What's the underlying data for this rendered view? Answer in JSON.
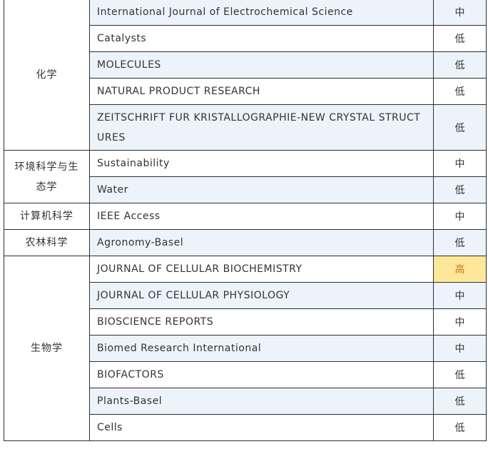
{
  "groups": [
    {
      "category": "化学",
      "rows": [
        {
          "journal": "International Journal of Electrochemical Science",
          "level": "中"
        },
        {
          "journal": "Catalysts",
          "level": "低"
        },
        {
          "journal": "MOLECULES",
          "level": "低"
        },
        {
          "journal": "NATURAL PRODUCT RESEARCH",
          "level": "低"
        },
        {
          "journal": "ZEITSCHRIFT FUR KRISTALLOGRAPHIE-NEW CRYSTAL STRUCTURES",
          "level": "低"
        }
      ]
    },
    {
      "category": "环境科学与生态学",
      "rows": [
        {
          "journal": "Sustainability",
          "level": "中"
        },
        {
          "journal": "Water",
          "level": "低"
        }
      ]
    },
    {
      "category": "计算机科学",
      "rows": [
        {
          "journal": "IEEE Access",
          "level": "中"
        }
      ]
    },
    {
      "category": "农林科学",
      "rows": [
        {
          "journal": "Agronomy-Basel",
          "level": "低"
        }
      ]
    },
    {
      "category": "生物学",
      "rows": [
        {
          "journal": "JOURNAL OF CELLULAR BIOCHEMISTRY",
          "level": "高"
        },
        {
          "journal": "JOURNAL OF CELLULAR PHYSIOLOGY",
          "level": "中"
        },
        {
          "journal": "BIOSCIENCE REPORTS",
          "level": "中"
        },
        {
          "journal": "Biomed Research International",
          "level": "中"
        },
        {
          "journal": "BIOFACTORS",
          "level": "低"
        },
        {
          "journal": "Plants-Basel",
          "level": "低"
        },
        {
          "journal": "Cells",
          "level": "低"
        }
      ]
    }
  ],
  "colors": {
    "row_tint": "#edf3fb",
    "high_highlight": "#fde89a",
    "high_text": "#c0781e",
    "border": "#2f2f2f"
  }
}
